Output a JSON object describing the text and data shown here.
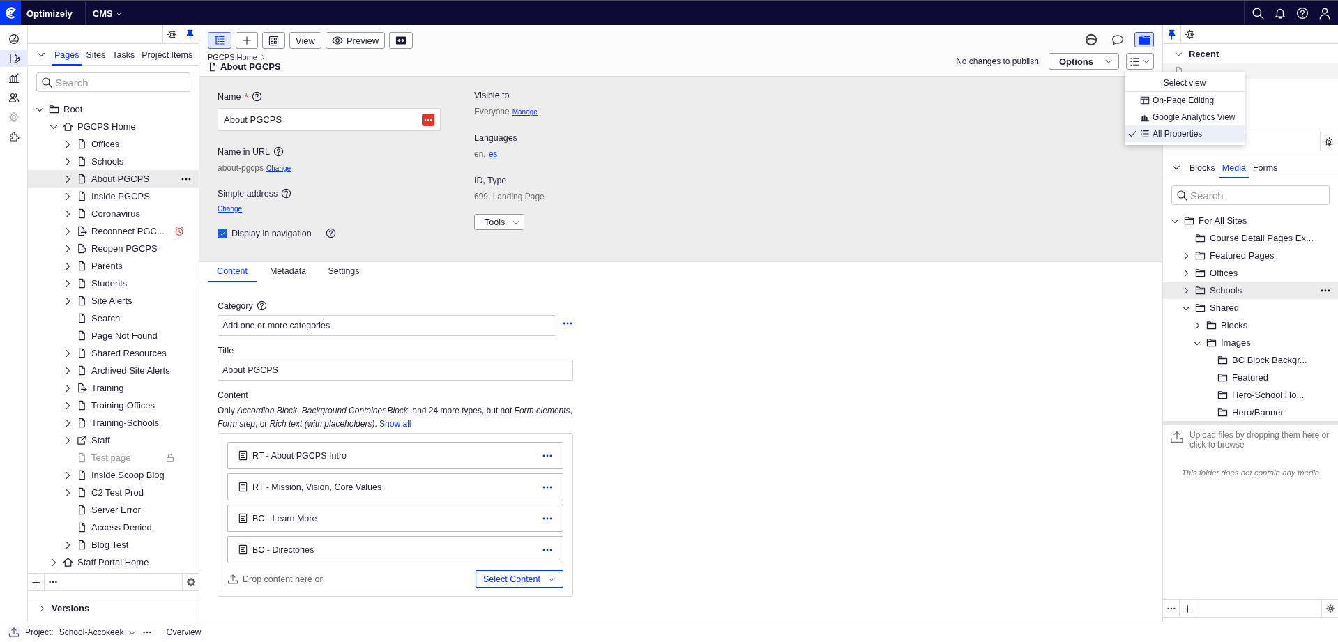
{
  "top_bar": {
    "product": "Optimizely",
    "app_menu": "CMS"
  },
  "rail": [
    {
      "kind": "dashboard",
      "selected": false,
      "disabled": false
    },
    {
      "kind": "edit",
      "selected": true,
      "disabled": false
    },
    {
      "kind": "reports",
      "selected": false,
      "disabled": false
    },
    {
      "kind": "visitors",
      "selected": false,
      "disabled": false
    },
    {
      "kind": "settings",
      "selected": false,
      "disabled": true
    },
    {
      "kind": "addons",
      "selected": false,
      "disabled": false
    }
  ],
  "left_pane": {
    "tabs": [
      {
        "label": "Pages",
        "selected": true
      },
      {
        "label": "Sites",
        "selected": false
      },
      {
        "label": "Tasks",
        "selected": false
      },
      {
        "label": "Project Items",
        "selected": false
      }
    ],
    "search": {
      "placeholder": "Search"
    },
    "tree": [
      {
        "label": "Root",
        "kind": "folder",
        "expandable": true,
        "expanded": true,
        "selected": false,
        "scheduled": false,
        "locked": false,
        "children": [
          {
            "label": "PGCPS Home",
            "kind": "home",
            "expandable": true,
            "expanded": true,
            "selected": false,
            "scheduled": false,
            "locked": false,
            "children": [
              {
                "label": "Offices",
                "kind": "page",
                "expandable": true,
                "expanded": false,
                "selected": false,
                "scheduled": false,
                "locked": false
              },
              {
                "label": "Schools",
                "kind": "page",
                "expandable": true,
                "expanded": false,
                "selected": false,
                "scheduled": false,
                "locked": false
              },
              {
                "label": "About PGCPS",
                "kind": "page",
                "expandable": true,
                "expanded": false,
                "selected": true,
                "scheduled": false,
                "locked": false
              },
              {
                "label": "Inside PGCPS",
                "kind": "page",
                "expandable": true,
                "expanded": false,
                "selected": false,
                "scheduled": false,
                "locked": false
              },
              {
                "label": "Coronavirus",
                "kind": "page",
                "expandable": true,
                "expanded": false,
                "selected": false,
                "scheduled": false,
                "locked": false
              },
              {
                "label": "Reconnect PGC...",
                "kind": "redirect",
                "expandable": true,
                "expanded": false,
                "selected": false,
                "scheduled": true,
                "locked": false
              },
              {
                "label": "Reopen PGCPS",
                "kind": "redirect",
                "expandable": true,
                "expanded": false,
                "selected": false,
                "scheduled": false,
                "locked": false
              },
              {
                "label": "Parents",
                "kind": "page",
                "expandable": true,
                "expanded": false,
                "selected": false,
                "scheduled": false,
                "locked": false
              },
              {
                "label": "Students",
                "kind": "page",
                "expandable": true,
                "expanded": false,
                "selected": false,
                "scheduled": false,
                "locked": false
              },
              {
                "label": "Site Alerts",
                "kind": "page",
                "expandable": true,
                "expanded": false,
                "selected": false,
                "scheduled": false,
                "locked": false
              },
              {
                "label": "Search",
                "kind": "page",
                "expandable": false,
                "selected": false,
                "scheduled": false,
                "locked": false
              },
              {
                "label": "Page Not Found",
                "kind": "page",
                "expandable": false,
                "selected": false,
                "scheduled": false,
                "locked": false
              },
              {
                "label": "Shared Resources",
                "kind": "page",
                "expandable": true,
                "expanded": false,
                "selected": false,
                "scheduled": false,
                "locked": false
              },
              {
                "label": "Archived Site Alerts",
                "kind": "page",
                "expandable": true,
                "expanded": false,
                "selected": false,
                "scheduled": false,
                "locked": false
              },
              {
                "label": "Training",
                "kind": "redirect",
                "expandable": true,
                "expanded": false,
                "selected": false,
                "scheduled": false,
                "locked": false
              },
              {
                "label": "Training-Offices",
                "kind": "page",
                "expandable": true,
                "expanded": false,
                "selected": false,
                "scheduled": false,
                "locked": false
              },
              {
                "label": "Training-Schools",
                "kind": "page",
                "expandable": true,
                "expanded": false,
                "selected": false,
                "scheduled": false,
                "locked": false
              },
              {
                "label": "Staff",
                "kind": "external",
                "expandable": true,
                "expanded": false,
                "selected": false,
                "scheduled": false,
                "locked": false
              },
              {
                "label": "Test page",
                "kind": "page",
                "expandable": false,
                "selected": false,
                "scheduled": false,
                "locked": true
              },
              {
                "label": "Inside Scoop Blog",
                "kind": "page",
                "expandable": true,
                "expanded": false,
                "selected": false,
                "scheduled": false,
                "locked": false
              },
              {
                "label": "C2 Test Prod",
                "kind": "page",
                "expandable": true,
                "expanded": false,
                "selected": false,
                "scheduled": false,
                "locked": false
              },
              {
                "label": "Server Error",
                "kind": "page",
                "expandable": false,
                "selected": false,
                "scheduled": false,
                "locked": false
              },
              {
                "label": "Access Denied",
                "kind": "page",
                "expandable": false,
                "selected": false,
                "scheduled": false,
                "locked": false
              },
              {
                "label": "Blog Test",
                "kind": "page",
                "expandable": true,
                "expanded": false,
                "selected": false,
                "scheduled": false,
                "locked": false
              }
            ]
          },
          {
            "label": "Staff Portal Home",
            "kind": "home",
            "expandable": true,
            "expanded": false,
            "selected": false,
            "scheduled": false,
            "locked": false
          }
        ]
      }
    ],
    "versions": "Versions"
  },
  "editor": {
    "toolbar": [
      {
        "kind": "tree",
        "selected": true
      },
      {
        "kind": "add",
        "selected": false
      },
      {
        "kind": "structure",
        "selected": false
      },
      {
        "kind": "text",
        "label": "View",
        "selected": false
      },
      {
        "kind": "preview",
        "label": "Preview",
        "selected": false
      },
      {
        "kind": "compare",
        "selected": false
      }
    ],
    "breadcrumb": "PGCPS Home",
    "title": "About PGCPS",
    "view_tools": [
      {
        "kind": "status",
        "selected": false
      },
      {
        "kind": "comments",
        "selected": false
      },
      {
        "kind": "assets",
        "selected": true
      }
    ],
    "status": "No changes to publish",
    "options_button": "Options",
    "view_menu": {
      "title": "Select view",
      "items": [
        {
          "label": "On-Page Editing",
          "kind": "onpage",
          "selected": false
        },
        {
          "label": "Google Analytics View",
          "kind": "analytics",
          "selected": false
        },
        {
          "label": "All Properties",
          "kind": "properties",
          "selected": true
        }
      ]
    },
    "properties": {
      "name": {
        "label": "Name",
        "required_mark": "*",
        "value": "About PGCPS"
      },
      "url": {
        "label": "Name in URL",
        "value": "about-pgcps",
        "link": "Change"
      },
      "simple_address": {
        "label": "Simple address",
        "link": "Change"
      },
      "display_in_navigation": {
        "label": "Display in navigation",
        "checked": true
      },
      "visible_to": {
        "label": "Visible to",
        "value": "Everyone",
        "link": "Manage"
      },
      "languages": {
        "label": "Languages",
        "value": "en,",
        "link": "es"
      },
      "id_type": {
        "label": "ID, Type",
        "value": "699, Landing Page"
      },
      "tools": "Tools"
    },
    "tabs": [
      {
        "label": "Content",
        "selected": true
      },
      {
        "label": "Metadata",
        "selected": false
      },
      {
        "label": "Settings",
        "selected": false
      }
    ],
    "content_tab": {
      "category": {
        "label": "Category",
        "placeholder": "Add one or more categories"
      },
      "title": {
        "label": "Title",
        "value": "About PGCPS"
      },
      "content": {
        "label": "Content",
        "note": "Only *Accordion Block*, *Background Container Block*, and 24 more types, but not *Form elements*, *Form step*, or *Rich text (with placeholders)*.",
        "show_all": "Show all",
        "items": [
          "RT - About PGCPS Intro",
          "RT - Mission, Vision, Core Values",
          "BC - Learn More",
          "BC - Directories"
        ],
        "drop_hint": "Drop content here or",
        "select_button": "Select Content"
      }
    }
  },
  "right_pane": {
    "recent": "Recent",
    "tabs": [
      {
        "label": "Blocks",
        "selected": false
      },
      {
        "label": "Media",
        "selected": true
      },
      {
        "label": "Forms",
        "selected": false
      }
    ],
    "search": {
      "placeholder": "Search"
    },
    "tree": [
      {
        "label": "For All Sites",
        "kind": "folder",
        "expandable": true,
        "expanded": true,
        "selected": false,
        "children": [
          {
            "label": "Course Detail Pages Ex...",
            "kind": "folder",
            "expandable": false,
            "selected": false
          },
          {
            "label": "Featured Pages",
            "kind": "folder",
            "expandable": true,
            "expanded": false,
            "selected": false
          },
          {
            "label": "Offices",
            "kind": "folder",
            "expandable": true,
            "expanded": false,
            "selected": false
          },
          {
            "label": "Schools",
            "kind": "folder",
            "expandable": true,
            "expanded": false,
            "selected": true
          },
          {
            "label": "Shared",
            "kind": "folder",
            "expandable": true,
            "expanded": true,
            "selected": false,
            "children": [
              {
                "label": "Blocks",
                "kind": "folder",
                "expandable": true,
                "expanded": false,
                "selected": false
              },
              {
                "label": "Images",
                "kind": "folder",
                "expandable": true,
                "expanded": true,
                "selected": false,
                "children": [
                  {
                    "label": "BC Block Backgr...",
                    "kind": "folder",
                    "expandable": false,
                    "selected": false
                  },
                  {
                    "label": "Featured",
                    "kind": "folder",
                    "expandable": false,
                    "selected": false
                  },
                  {
                    "label": "Hero-School Ho...",
                    "kind": "folder",
                    "expandable": false,
                    "selected": false
                  },
                  {
                    "label": "Hero/Banner",
                    "kind": "folder",
                    "expandable": false,
                    "selected": false
                  }
                ]
              }
            ]
          }
        ]
      }
    ],
    "upload_hint": "Upload files by dropping them here or click to browse",
    "empty_message": "This folder does not contain any media"
  },
  "project_bar": {
    "label": "Project:",
    "project": "School-Accokeek",
    "overview": "Overview"
  }
}
